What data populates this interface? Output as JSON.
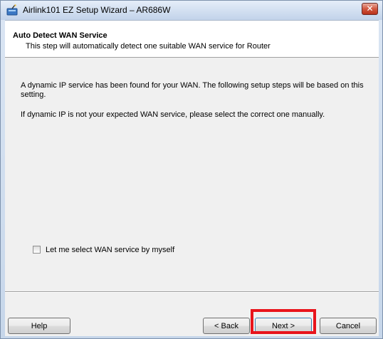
{
  "window": {
    "title": "Airlink101 EZ Setup Wizard – AR686W",
    "close_glyph": "✕"
  },
  "header": {
    "title": "Auto Detect WAN Service",
    "subtitle": "This step will automatically detect one suitable WAN service for Router"
  },
  "body": {
    "paragraph1": "A dynamic IP service has been found for your WAN. The following setup steps will be based on this setting.",
    "paragraph2": "If dynamic IP is not your expected WAN service, please select the correct one manually."
  },
  "checkbox": {
    "label": "Let me select WAN service by myself",
    "checked": false
  },
  "buttons": {
    "help": "Help",
    "back": "< Back",
    "next": "Next >",
    "cancel": "Cancel"
  },
  "colors": {
    "highlight": "#e8141c",
    "title_bar": "#d3e0f1",
    "close_button": "#d2573f"
  },
  "icons": {
    "app": "wizard-app-icon",
    "close": "close-icon"
  }
}
